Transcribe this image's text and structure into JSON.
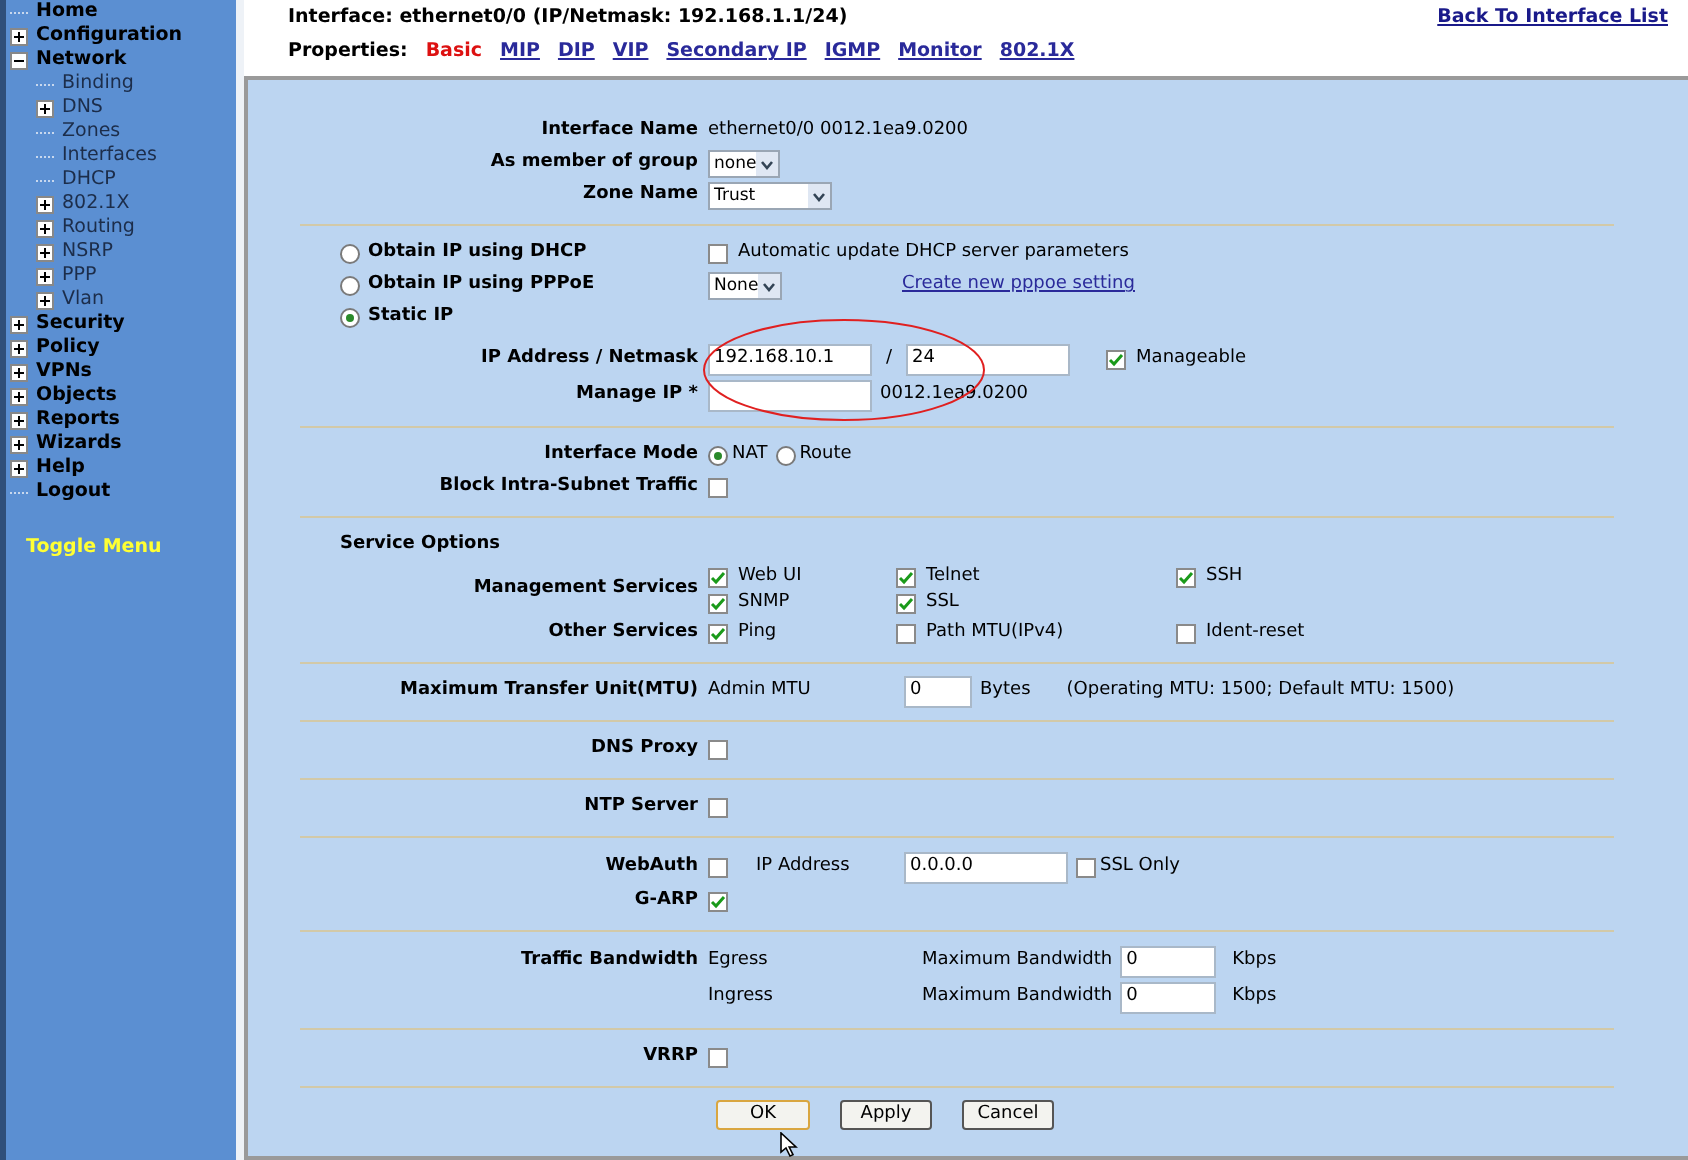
{
  "sidebar": {
    "items": [
      {
        "label": "Home",
        "kind": "leaf"
      },
      {
        "label": "Configuration",
        "kind": "folder",
        "expanded": false
      },
      {
        "label": "Network",
        "kind": "folder",
        "expanded": true,
        "children": [
          {
            "label": "Binding",
            "kind": "leaf"
          },
          {
            "label": "DNS",
            "kind": "folder",
            "expanded": false
          },
          {
            "label": "Zones",
            "kind": "leaf"
          },
          {
            "label": "Interfaces",
            "kind": "leaf"
          },
          {
            "label": "DHCP",
            "kind": "leaf"
          },
          {
            "label": "802.1X",
            "kind": "folder",
            "expanded": false
          },
          {
            "label": "Routing",
            "kind": "folder",
            "expanded": false
          },
          {
            "label": "NSRP",
            "kind": "folder",
            "expanded": false
          },
          {
            "label": "PPP",
            "kind": "folder",
            "expanded": false
          },
          {
            "label": "Vlan",
            "kind": "folder",
            "expanded": false
          }
        ]
      },
      {
        "label": "Security",
        "kind": "folder",
        "expanded": false
      },
      {
        "label": "Policy",
        "kind": "folder",
        "expanded": false
      },
      {
        "label": "VPNs",
        "kind": "folder",
        "expanded": false
      },
      {
        "label": "Objects",
        "kind": "folder",
        "expanded": false
      },
      {
        "label": "Reports",
        "kind": "folder",
        "expanded": false
      },
      {
        "label": "Wizards",
        "kind": "folder",
        "expanded": false
      },
      {
        "label": "Help",
        "kind": "folder",
        "expanded": false
      },
      {
        "label": "Logout",
        "kind": "leaf"
      }
    ],
    "toggle": "Toggle Menu"
  },
  "header": {
    "title": "Interface: ethernet0/0 (IP/Netmask: 192.168.1.1/24)",
    "back_link": "Back To Interface List"
  },
  "properties": {
    "label": "Properties:",
    "tabs": [
      {
        "label": "Basic",
        "selected": true
      },
      {
        "label": "MIP",
        "selected": false
      },
      {
        "label": "DIP",
        "selected": false
      },
      {
        "label": "VIP",
        "selected": false
      },
      {
        "label": "Secondary IP",
        "selected": false
      },
      {
        "label": "IGMP",
        "selected": false
      },
      {
        "label": "Monitor",
        "selected": false
      },
      {
        "label": "802.1X",
        "selected": false
      }
    ]
  },
  "interface_name": {
    "label": "Interface Name",
    "value": "ethernet0/0 0012.1ea9.0200"
  },
  "group": {
    "label": "As member of group",
    "value": "none"
  },
  "zone": {
    "label": "Zone Name",
    "value": "Trust"
  },
  "ip_modes": [
    {
      "label": "Obtain IP using DHCP",
      "selected": false
    },
    {
      "label": "Obtain IP using PPPoE",
      "selected": false
    },
    {
      "label": "Static IP",
      "selected": true
    }
  ],
  "dhcp_auto_update": {
    "label": "Automatic update DHCP server parameters",
    "checked": false
  },
  "pppoe": {
    "value": "None",
    "link": "Create new pppoe setting"
  },
  "ip_netmask": {
    "label": "IP Address / Netmask",
    "ip": "192.168.10.1",
    "separator": "/",
    "mask": "24",
    "manageable": {
      "label": "Manageable",
      "checked": true
    }
  },
  "manage_ip": {
    "label": "Manage IP *",
    "mac": "0012.1ea9.0200"
  },
  "interface_mode": {
    "label": "Interface Mode",
    "options": [
      {
        "label": "NAT",
        "selected": true
      },
      {
        "label": "Route",
        "selected": false
      }
    ]
  },
  "block_intra_subnet": {
    "label": "Block Intra-Subnet Traffic",
    "checked": false
  },
  "service_options": {
    "title": "Service Options",
    "groups": [
      {
        "label": "Management Services",
        "rows": [
          [
            {
              "label": "Web UI",
              "checked": true
            },
            {
              "label": "Telnet",
              "checked": true
            },
            {
              "label": "SSH",
              "checked": true
            }
          ],
          [
            {
              "label": "SNMP",
              "checked": true
            },
            {
              "label": "SSL",
              "checked": true
            }
          ]
        ]
      },
      {
        "label": "Other Services",
        "rows": [
          [
            {
              "label": "Ping",
              "checked": true
            },
            {
              "label": "Path MTU(IPv4)",
              "checked": false
            },
            {
              "label": "Ident-reset",
              "checked": false
            }
          ]
        ]
      }
    ]
  },
  "mtu": {
    "label": "Maximum Transfer Unit(MTU)",
    "sublabel": "Admin MTU",
    "value": "0",
    "unit": "Bytes",
    "note": "(Operating MTU: 1500; Default MTU: 1500)"
  },
  "dns_proxy": {
    "label": "DNS Proxy",
    "checked": false
  },
  "ntp_server": {
    "label": "NTP Server",
    "checked": false
  },
  "webauth": {
    "label": "WebAuth",
    "checked": false,
    "ip_label": "IP Address",
    "ip": "0.0.0.0",
    "ssl_only": {
      "label": "SSL Only",
      "checked": false
    }
  },
  "garp": {
    "label": "G-ARP",
    "checked": true
  },
  "traffic_bandwidth": {
    "label": "Traffic Bandwidth",
    "rows": [
      {
        "direction": "Egress",
        "label": "Maximum Bandwidth",
        "value": "0",
        "unit": "Kbps"
      },
      {
        "direction": "Ingress",
        "label": "Maximum Bandwidth",
        "value": "0",
        "unit": "Kbps"
      }
    ]
  },
  "vrrp": {
    "label": "VRRP",
    "checked": false
  },
  "buttons": [
    {
      "label": "OK",
      "default": true
    },
    {
      "label": "Apply",
      "default": false
    },
    {
      "label": "Cancel",
      "default": false
    }
  ]
}
